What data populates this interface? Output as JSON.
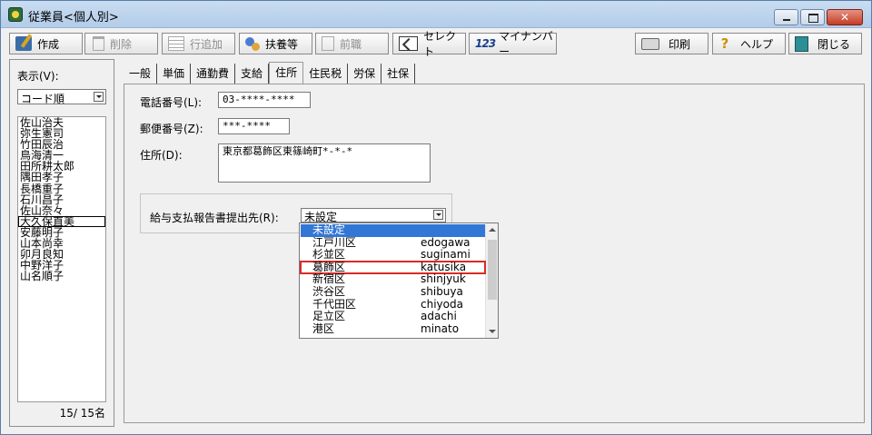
{
  "window": {
    "title": "従業員<個人別>"
  },
  "toolbar": {
    "create": "作成",
    "delete": "削除",
    "add_row": "行追加",
    "dependents": "扶養等",
    "previous_job": "前職",
    "select": "セレクト",
    "mynumber_prefix": "123",
    "mynumber": "マイナンバー",
    "print": "印刷",
    "help": "ヘルプ",
    "close": "閉じる"
  },
  "left_panel": {
    "display_label": "表示(V):",
    "sort_value": "コード順",
    "employees": [
      "佐山治夫",
      "弥生憲司",
      "竹田辰治",
      "鳥海清一",
      "田所耕太郎",
      "隅田孝子",
      "長橋重子",
      "石川昌子",
      "佐山奈々",
      "大久保直美",
      "安藤明子",
      "山本尚幸",
      "卯月良知",
      "中野洋子",
      "山名順子"
    ],
    "selected_index": 9,
    "count": "15/ 15名"
  },
  "tabs": [
    "一般",
    "単価",
    "通勤費",
    "支給",
    "住所",
    "住民税",
    "労保",
    "社保"
  ],
  "active_tab_index": 4,
  "form": {
    "phone_label": "電話番号(L):",
    "phone_value": "03-****-****",
    "postal_label": "郵便番号(Z):",
    "postal_value": "***-****",
    "address_label": "住所(D):",
    "address_value": "東京都葛飾区東篠崎町*-*-*",
    "submit_to_label": "給与支払報告書提出先(R):",
    "submit_to_value": "未設定"
  },
  "dropdown_options": [
    {
      "name": "未設定",
      "romaji": ""
    },
    {
      "name": "江戸川区",
      "romaji": "edogawa"
    },
    {
      "name": "杉並区",
      "romaji": "suginami"
    },
    {
      "name": "葛飾区",
      "romaji": "katusika"
    },
    {
      "name": "新宿区",
      "romaji": "shinjyuk"
    },
    {
      "name": "渋谷区",
      "romaji": "shibuya"
    },
    {
      "name": "千代田区",
      "romaji": "chiyoda"
    },
    {
      "name": "足立区",
      "romaji": "adachi"
    },
    {
      "name": "港区",
      "romaji": "minato"
    }
  ],
  "dropdown_selected_index": 0,
  "dropdown_highlight_index": 3,
  "colors": {
    "selection": "#3377d6",
    "highlight_border": "#d82a2a"
  }
}
